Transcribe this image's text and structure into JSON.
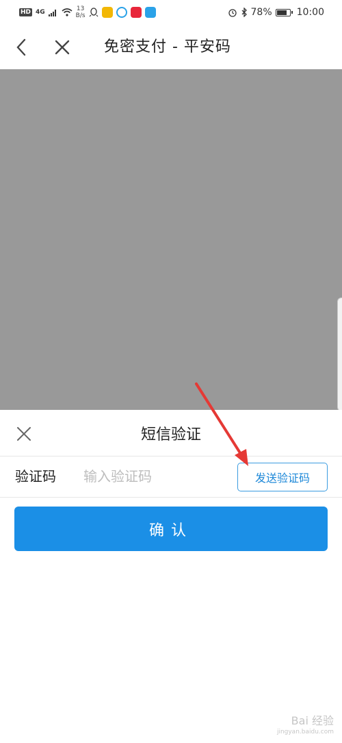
{
  "status_bar": {
    "hd": "HD",
    "network": "4G",
    "speed_top": "13",
    "speed_bottom": "B/s",
    "battery": "78%",
    "time": "10:00"
  },
  "nav": {
    "title": "免密支付 - 平安码"
  },
  "sheet": {
    "title": "短信验证",
    "code_label": "验证码",
    "code_placeholder": "输入验证码",
    "code_value": "",
    "send_button": "发送验证码",
    "confirm_button": "确认"
  },
  "watermark": {
    "text": "Bai 经验",
    "url": "jingyan.baidu.com"
  },
  "colors": {
    "accent": "#1b8fe6",
    "overlay": "#999999",
    "annotation_arrow": "#e53935"
  }
}
